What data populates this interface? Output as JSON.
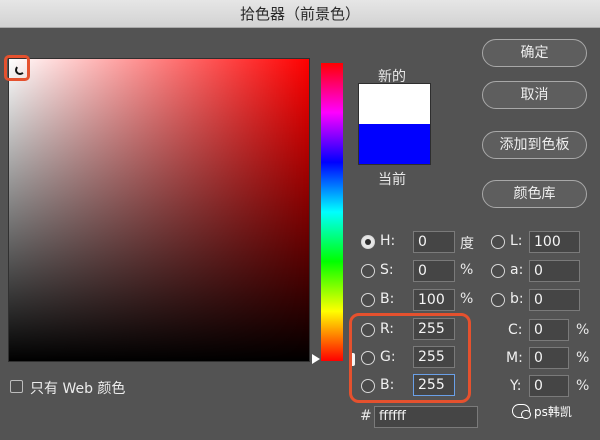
{
  "window": {
    "title": "拾色器（前景色）"
  },
  "swatches": {
    "new_label": "新的",
    "current_label": "当前",
    "new_color": "#ffffff",
    "current_color": "#0000ff"
  },
  "buttons": {
    "ok": "确定",
    "cancel": "取消",
    "add_to_swatches": "添加到色板",
    "color_libraries": "颜色库"
  },
  "fields": {
    "hsb": [
      {
        "id": "H",
        "label": "H:",
        "value": "0",
        "unit": "度",
        "selected": true
      },
      {
        "id": "S",
        "label": "S:",
        "value": "0",
        "unit": "%",
        "selected": false
      },
      {
        "id": "B",
        "label": "B:",
        "value": "100",
        "unit": "%",
        "selected": false
      }
    ],
    "rgb": [
      {
        "id": "R",
        "label": "R:",
        "value": "255",
        "selected": false
      },
      {
        "id": "G",
        "label": "G:",
        "value": "255",
        "selected": false
      },
      {
        "id": "B",
        "label": "B:",
        "value": "255",
        "selected": false
      }
    ],
    "lab": [
      {
        "id": "L",
        "label": "L:",
        "value": "100",
        "selected": false
      },
      {
        "id": "a",
        "label": "a:",
        "value": "0",
        "selected": false
      },
      {
        "id": "b",
        "label": "b:",
        "value": "0",
        "selected": false
      }
    ],
    "cmyk": [
      {
        "id": "C",
        "label": "C:",
        "value": "0",
        "unit": "%"
      },
      {
        "id": "M",
        "label": "M:",
        "value": "0",
        "unit": "%"
      },
      {
        "id": "Y",
        "label": "Y:",
        "value": "0",
        "unit": "%"
      }
    ],
    "hex": {
      "label": "#",
      "value": "ffffff"
    }
  },
  "web_only": {
    "label": "只有 Web 颜色",
    "checked": false
  },
  "watermark": {
    "text": "ps韩凯"
  },
  "colors": {
    "accent_highlight": "#e5512e",
    "base_hue": "#ff0000"
  }
}
